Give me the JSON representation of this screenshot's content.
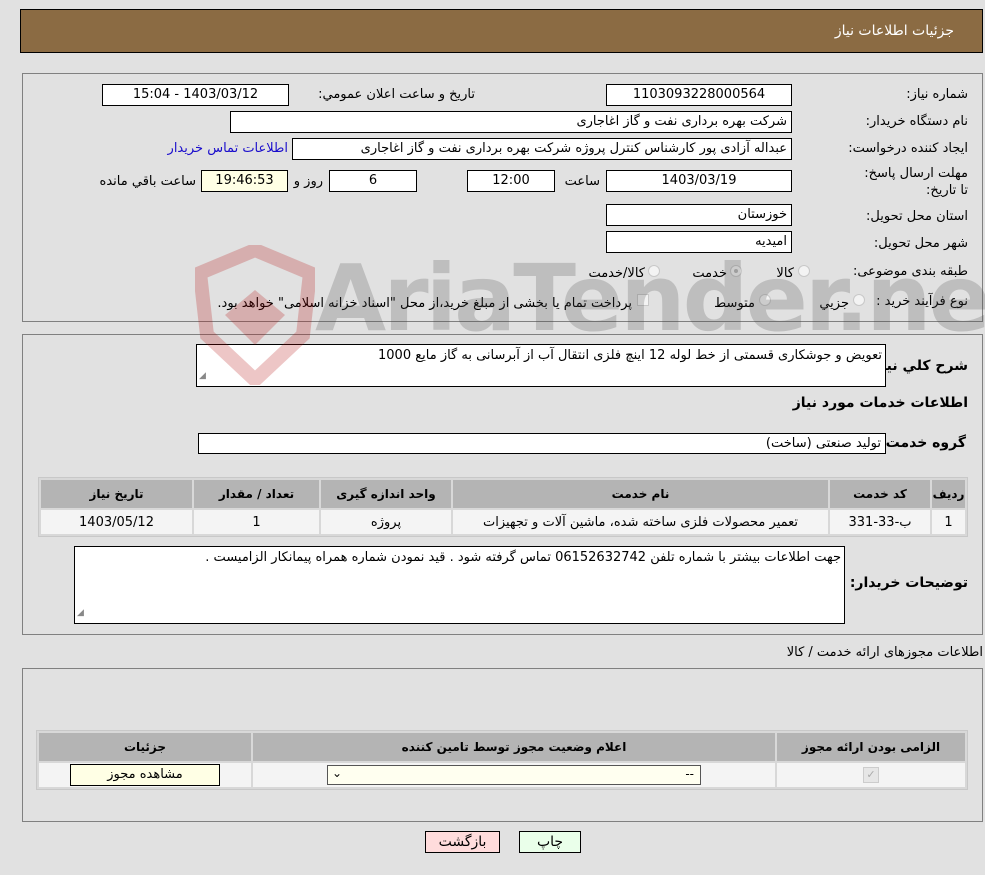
{
  "header": {
    "title": "جزئیات اطلاعات نیاز"
  },
  "form": {
    "need_number": {
      "label": "شماره نیاز:",
      "value": "1103093228000564"
    },
    "announce": {
      "label": "تاریخ و ساعت اعلان عمومي:",
      "value": "1403/03/12 - 15:04"
    },
    "buyer_org": {
      "label": "نام دستگاه خریدار:",
      "value": "شرکت بهره برداری نفت و گاز اغاجاری"
    },
    "creator": {
      "label": "ایجاد کننده درخواست:",
      "value": "عبداله آزادی پور کارشناس کنترل پروژه شرکت بهره برداری نفت و گاز اغاجاری",
      "contact_link": "اطلاعات تماس خریدار"
    },
    "deadline": {
      "label": "مهلت ارسال پاسخ: تا تاریخ:",
      "date": "1403/03/19",
      "time_label": "ساعت",
      "time": "12:00",
      "days": "6",
      "days_label": "روز و",
      "remaining": "19:46:53",
      "remaining_label": "ساعت باقي مانده"
    },
    "province": {
      "label": "استان محل تحویل:",
      "value": "خوزستان"
    },
    "city": {
      "label": "شهر محل تحویل:",
      "value": "امیدیه"
    },
    "category": {
      "label": "طبقه بندی موضوعی:",
      "options": [
        "کالا",
        "خدمت",
        "کالا/خدمت"
      ],
      "selected": "خدمت"
    },
    "purchase_type": {
      "label": "نوع فرآیند خرید :",
      "options": [
        "جزيي",
        "متوسط"
      ],
      "treasury_note": "پرداخت تمام یا بخشی از مبلغ خرید،از محل \"اسناد خزانه اسلامی\" خواهد بود."
    }
  },
  "description": {
    "label": "شرح کلي نیاز:",
    "value": "تعویض و جوشکاری قسمتی از خط لوله 12 اینچ فلزی انتقال آب از آبرسانی به گاز مایع 1000",
    "services_title": "اطلاعات خدمات مورد نیاز",
    "service_group_label": "گروه خدمت:",
    "service_group_value": "تولید صنعتی (ساخت)"
  },
  "services_table": {
    "headers": [
      "ردیف",
      "کد خدمت",
      "نام خدمت",
      "واحد اندازه گیری",
      "تعداد / مقدار",
      "تاریخ نیاز"
    ],
    "rows": [
      [
        "1",
        "ب-33-331",
        "تعمیر محصولات فلزی ساخته شده، ماشین آلات و تجهیزات",
        "پروژه",
        "1",
        "1403/05/12"
      ]
    ]
  },
  "buyer_notes": {
    "label": "توضیحات خریدار:",
    "value": "جهت اطلاعات بیشتر با شماره تلفن 06152632742 تماس گرفته شود . قید نمودن شماره همراه پیمانکار الزامیست ."
  },
  "licenses": {
    "title": "اطلاعات مجوزهای ارائه خدمت / کالا",
    "headers": [
      "الزامی بودن ارائه مجوز",
      "اعلام وضعیت مجوز توسط تامین کننده",
      "جزئیات"
    ],
    "row": {
      "required_checked": true,
      "status_value": "--",
      "details_button": "مشاهده مجوز"
    }
  },
  "footer": {
    "print_button": "چاپ",
    "back_button": "بازگشت"
  },
  "watermark": {
    "text": "AriaTender.neT"
  }
}
